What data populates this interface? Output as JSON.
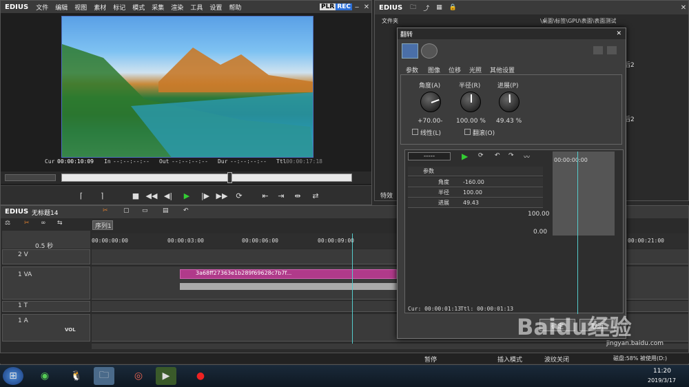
{
  "player": {
    "logo": "EDIUS",
    "menu": [
      "文件",
      "编辑",
      "视图",
      "素材",
      "标记",
      "模式",
      "采集",
      "渲染",
      "工具",
      "设置",
      "帮助"
    ],
    "plr": "PLR",
    "rec": "REC",
    "timecodes": {
      "cur_label": "Cur",
      "cur": "00:00:10:09",
      "in_label": "In",
      "in": "--:--:--:--",
      "out_label": "Out",
      "out": "--:--:--:--",
      "dur_label": "Dur",
      "dur": "--:--:--:--",
      "ttl_label": "Ttl",
      "ttl": "00:00:17:18"
    }
  },
  "bin": {
    "logo": "EDIUS",
    "folder_label": "文件夹",
    "path": "\\桌面\\标签\\GPU\\表面\\表面测试",
    "items": [
      "后2",
      "后2"
    ],
    "effect_label": "特效"
  },
  "timeline": {
    "logo": "EDIUS",
    "project": "无标题14",
    "sequence_tab": "序列1",
    "scale": "0.5 秒",
    "ruler": [
      "00:00:00:00",
      "00:00:03:00",
      "00:00:06:00",
      "00:00:09:00",
      "00:00:21:00"
    ],
    "tracks": [
      {
        "name": "2 V"
      },
      {
        "name": "1 VA"
      },
      {
        "name": "1 T"
      },
      {
        "name": "1 A"
      }
    ],
    "clip_name": "3a68ff27363e1b289f69628c7b7f...",
    "vol_label": "VOL"
  },
  "dialog": {
    "title": "翻转",
    "tabs": [
      "参数",
      "图像",
      "位移",
      "光照",
      "其他设置"
    ],
    "knobs": [
      {
        "label": "角度(A)",
        "value": "+70.00-"
      },
      {
        "label": "半径(R)",
        "value": "100.00 %"
      },
      {
        "label": "进展(P)",
        "value": "49.43 %"
      }
    ],
    "check_linear": "线性(L)",
    "check_flip": "翻滚(O)",
    "dropdown": "-----",
    "params_root": "参数",
    "params": [
      {
        "name": "角度",
        "value": "-160.00"
      },
      {
        "name": "半径",
        "value": "100.00"
      },
      {
        "name": "进展",
        "value": "49.43"
      }
    ],
    "graph_max": "100.00",
    "graph_min": "0.00",
    "kf_time": "00:00:00:00",
    "cur": "Cur: 00:00:01:13",
    "ttl": "Ttl: 00:00:01:13",
    "ok": "确定",
    "cancel": "取消"
  },
  "status": {
    "pause": "暂停",
    "insert_mode": "插入模式",
    "ripple": "波纹关闭",
    "disk": "磁盘:58% 被使用(D:)"
  },
  "taskbar": {
    "time": "11:20",
    "date": "2019/3/17"
  },
  "watermark": "Baidu经验",
  "watermark_url": "jingyan.baidu.com"
}
